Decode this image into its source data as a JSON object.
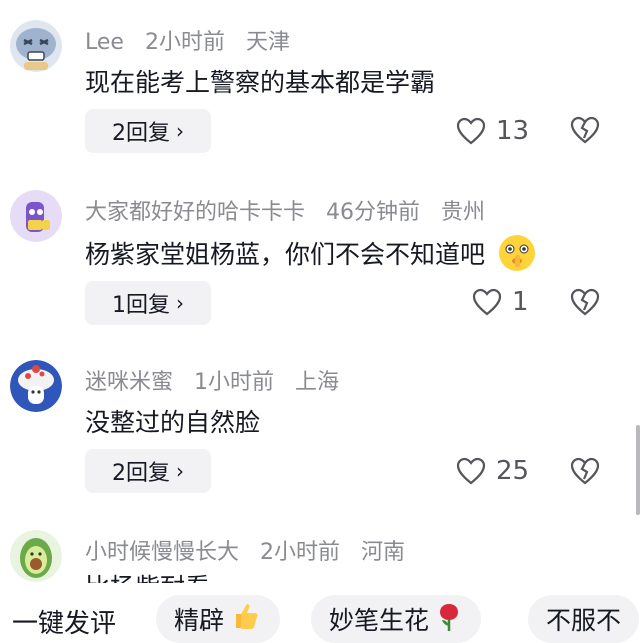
{
  "comments": [
    {
      "username": "Lee",
      "time": "2小时前",
      "location": "天津",
      "text": "现在能考上警察的基本都是学霸",
      "reply_label": "2回复",
      "likes": "13",
      "avatar_icon": "cartoon-face-avatar-icon"
    },
    {
      "username": "大家都好好的哈卡卡卡",
      "time": "46分钟前",
      "location": "贵州",
      "text": "杨紫家堂姐杨蓝，你们不会不知道吧",
      "reply_label": "1回复",
      "likes": "1",
      "avatar_icon": "purple-cartoon-avatar-icon"
    },
    {
      "username": "迷咪米蜜",
      "time": "1小时前",
      "location": "上海",
      "text": "没整过的自然脸",
      "reply_label": "2回复",
      "likes": "25",
      "avatar_icon": "mushroom-character-avatar-icon"
    },
    {
      "username": "小时候慢慢长大",
      "time": "2小时前",
      "location": "河南",
      "text": "比杨紫耐看",
      "avatar_icon": "avocado-avatar-icon"
    }
  ],
  "quick_reply": {
    "title": "一键发评",
    "chips": [
      "精辟",
      "妙笔生花",
      "不服不"
    ]
  },
  "colors": {
    "text_primary": "#161823",
    "text_secondary": "#8a8b91",
    "reply_bg": "#f2f2f4",
    "icon_gray": "#55565c"
  }
}
